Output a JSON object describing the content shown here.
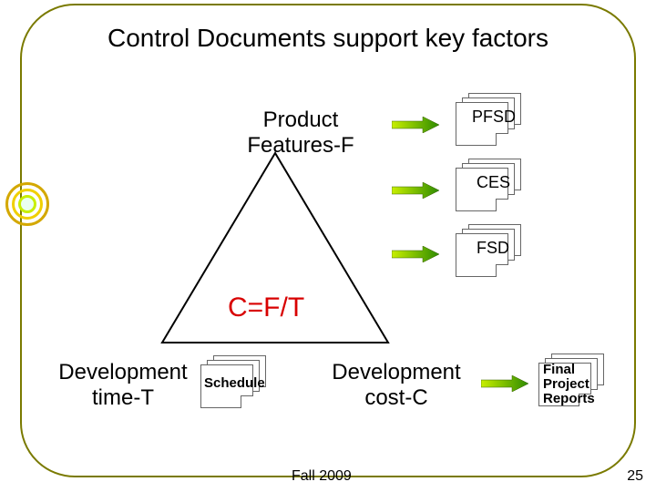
{
  "title": "Control Documents support key factors",
  "product_features": "Product\nFeatures-F",
  "formula": "C=F/T",
  "dev_time": "Development\ntime-T",
  "dev_cost": "Development\ncost-C",
  "docs": {
    "pfsd": "PFSD",
    "ces": "CES",
    "fsd": "FSD",
    "schedule": "Schedule",
    "final": "Final\nProject\nReports"
  },
  "footer_center": "Fall 2009",
  "footer_right": "25"
}
